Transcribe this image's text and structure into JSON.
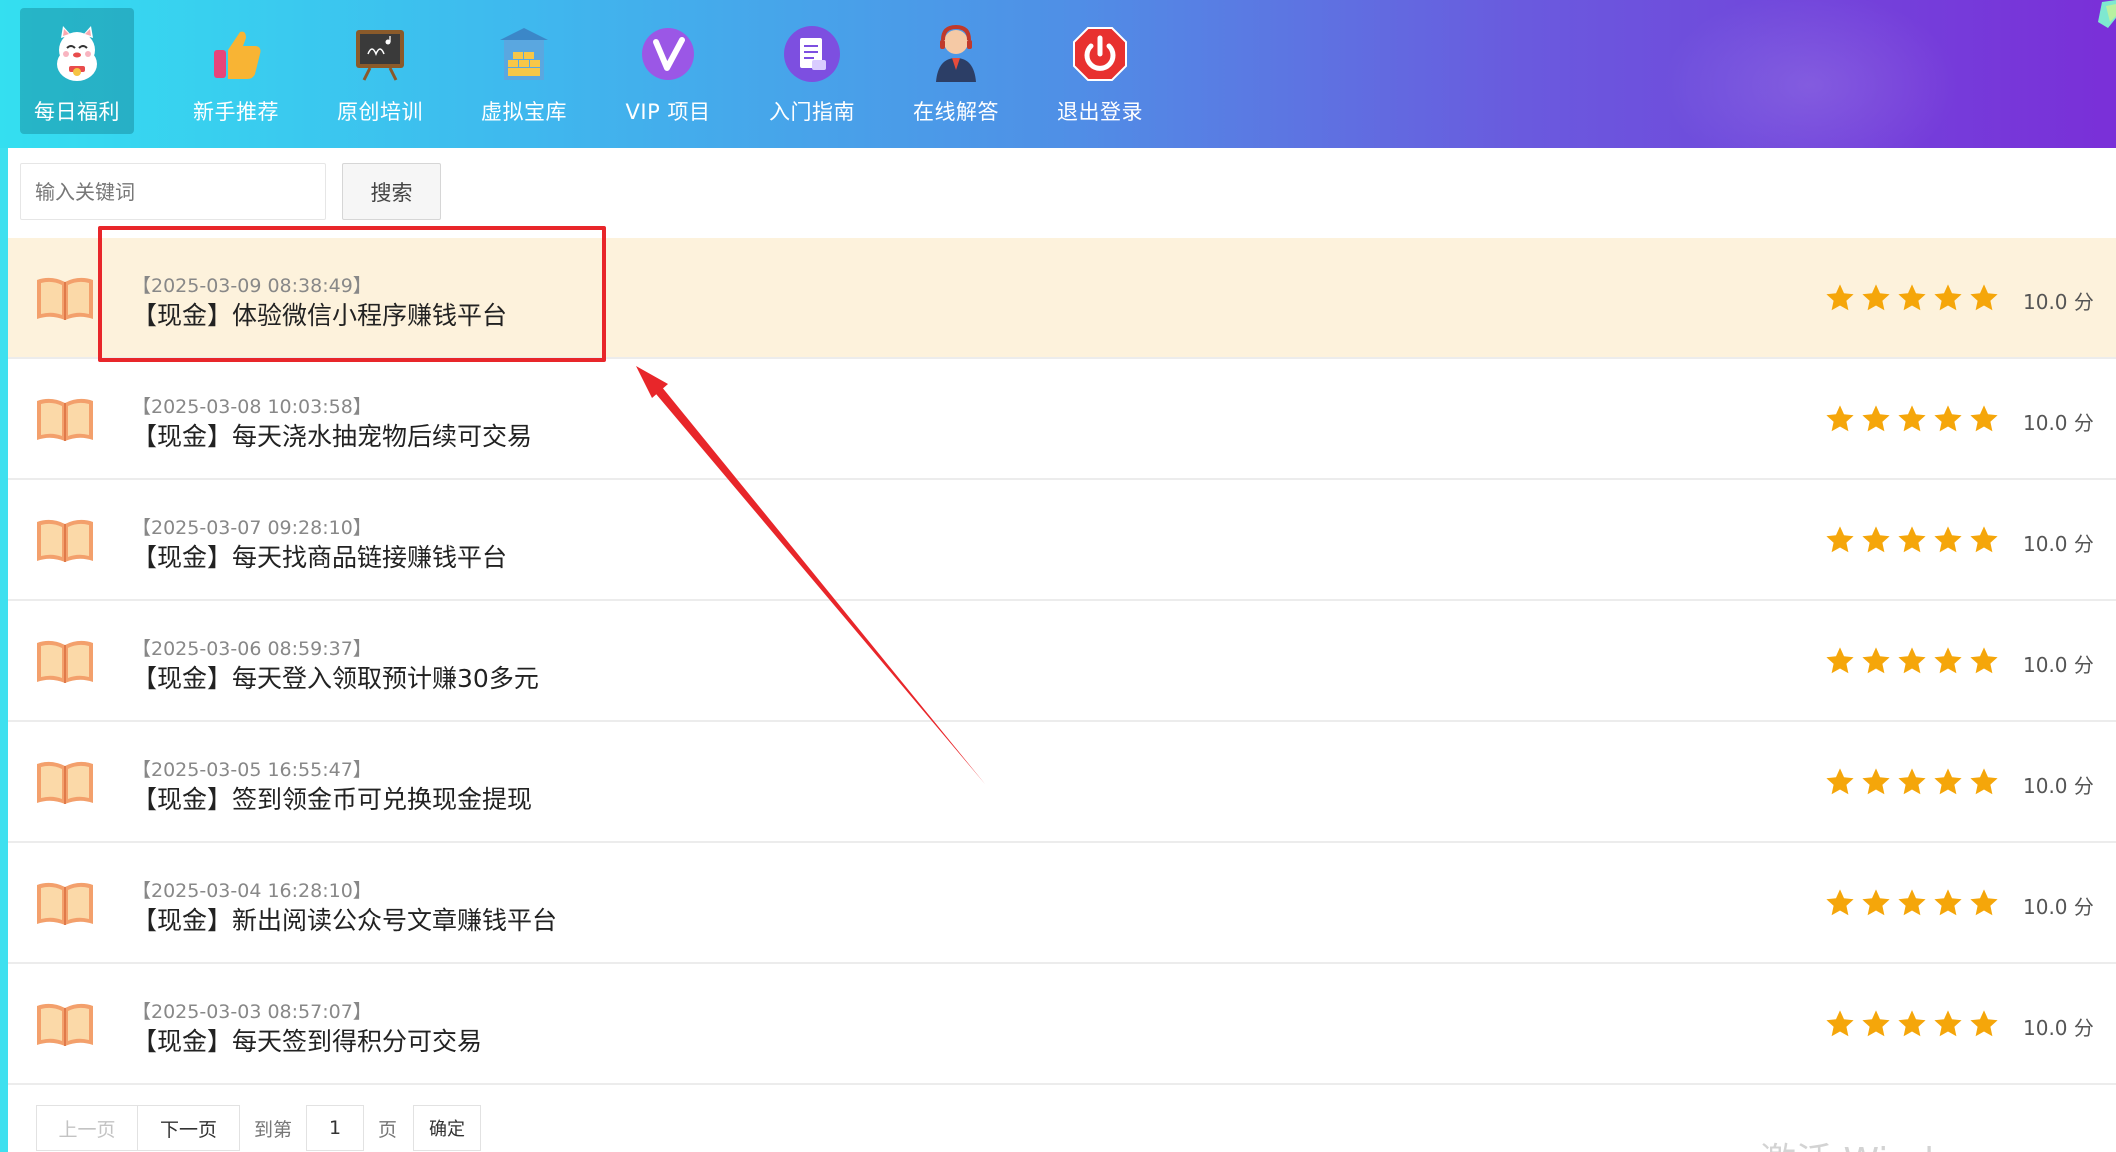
{
  "nav": {
    "items": [
      {
        "label": "每日福利",
        "icon": "lucky-cat-icon",
        "active": true
      },
      {
        "label": "新手推荐",
        "icon": "thumbs-up-icon",
        "active": false
      },
      {
        "label": "原创培训",
        "icon": "chalkboard-icon",
        "active": false
      },
      {
        "label": "虚拟宝库",
        "icon": "treasury-icon",
        "active": false
      },
      {
        "label": "VIP 项目",
        "icon": "vip-icon",
        "active": false
      },
      {
        "label": "入门指南",
        "icon": "guide-document-icon",
        "active": false
      },
      {
        "label": "在线解答",
        "icon": "support-agent-icon",
        "active": false
      },
      {
        "label": "退出登录",
        "icon": "power-off-icon",
        "active": false
      }
    ]
  },
  "search": {
    "placeholder": "输入关键词",
    "button_label": "搜索"
  },
  "list": {
    "items": [
      {
        "timestamp": "【2025-03-09 08:38:49】",
        "title": "【现金】体验微信小程序赚钱平台",
        "rating": 5,
        "score": "10.0 分",
        "highlighted": true
      },
      {
        "timestamp": "【2025-03-08 10:03:58】",
        "title": "【现金】每天浇水抽宠物后续可交易",
        "rating": 5,
        "score": "10.0 分",
        "highlighted": false
      },
      {
        "timestamp": "【2025-03-07 09:28:10】",
        "title": "【现金】每天找商品链接赚钱平台",
        "rating": 5,
        "score": "10.0 分",
        "highlighted": false
      },
      {
        "timestamp": "【2025-03-06 08:59:37】",
        "title": "【现金】每天登入领取预计赚30多元",
        "rating": 5,
        "score": "10.0 分",
        "highlighted": false
      },
      {
        "timestamp": "【2025-03-05 16:55:47】",
        "title": "【现金】签到领金币可兑换现金提现",
        "rating": 5,
        "score": "10.0 分",
        "highlighted": false
      },
      {
        "timestamp": "【2025-03-04 16:28:10】",
        "title": "【现金】新出阅读公众号文章赚钱平台",
        "rating": 5,
        "score": "10.0 分",
        "highlighted": false
      },
      {
        "timestamp": "【2025-03-03 08:57:07】",
        "title": "【现金】每天签到得积分可交易",
        "rating": 5,
        "score": "10.0 分",
        "highlighted": false
      }
    ]
  },
  "pagination": {
    "prev_label": "上一页",
    "next_label": "下一页",
    "goto_label": "到第",
    "page_value": "1",
    "page_suffix": "页",
    "confirm_label": "确定"
  },
  "watermark": {
    "text": "激活 Windows"
  },
  "colors": {
    "highlight_row": "#fdf2dc",
    "annotation_red": "#e8262a",
    "star": "#f5a60a",
    "book": "#f0a070"
  }
}
